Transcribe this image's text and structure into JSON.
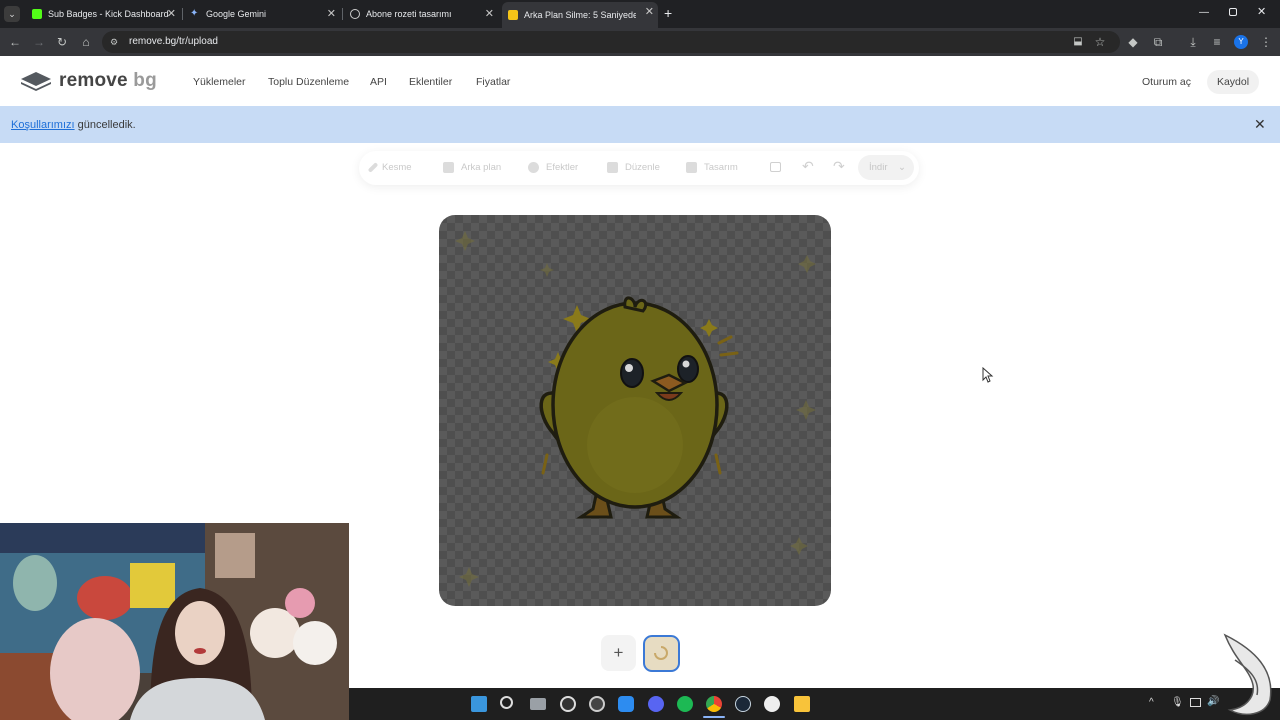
{
  "browser": {
    "tabs": [
      {
        "title": "Sub Badges - Kick Dashboard",
        "active": false
      },
      {
        "title": "Google Gemini",
        "active": false
      },
      {
        "title": "Abone rozeti tasarımı",
        "active": false
      },
      {
        "title": "Arka Plan Silme: 5 Saniyede Mü",
        "active": true
      }
    ],
    "new_tab": "+",
    "url": "remove.bg/tr/upload",
    "profile_initial": "Y"
  },
  "site": {
    "logo_main": "remove",
    "logo_accent": "bg",
    "nav": [
      "Yüklemeler",
      "Toplu Düzenleme",
      "API",
      "Eklentiler",
      "Fiyatlar"
    ],
    "login": "Oturum aç",
    "signup": "Kaydol"
  },
  "banner": {
    "link": "Koşullarımızı",
    "text": " güncelledik.",
    "close": "✕"
  },
  "editor": {
    "tools": [
      "Kesme",
      "Arka plan",
      "Efektler",
      "Düzenle",
      "Tasarım"
    ],
    "download": "İndir",
    "add_image": "+"
  },
  "colors": {
    "accent_blue": "#3b79d6",
    "banner_bg": "#c7dbf5",
    "chick_yellow": "#6b6618"
  },
  "taskbar": {
    "apps": [
      "windows-start",
      "search",
      "task-view",
      "obs",
      "app-red",
      "app-blue",
      "discord",
      "spotify",
      "chrome",
      "steam",
      "app-white",
      "file-explorer"
    ]
  }
}
